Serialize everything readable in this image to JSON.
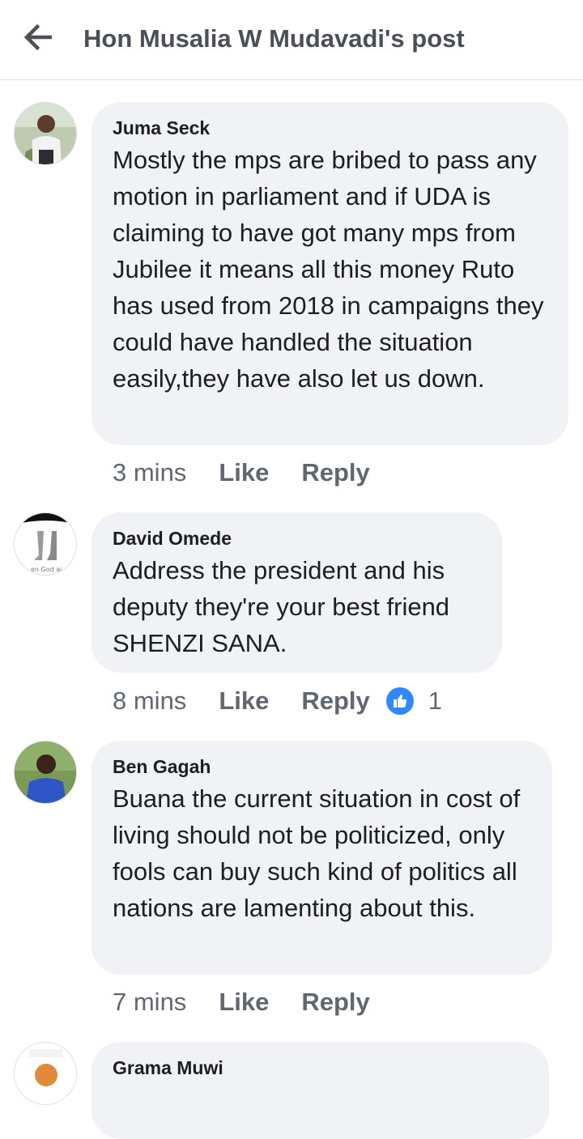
{
  "header": {
    "title": "Hon Musalia W Mudavadi's post",
    "back_icon": "arrow-left-icon"
  },
  "comments": [
    {
      "author": "Juma Seck",
      "text": "Mostly the mps are bribed to pass any motion in parliament and if UDA is claiming to have got many mps from Jubilee it means all this money Ruto has used from 2018 in campaigns they could have handled the situation easily,they have also let us down.",
      "time": "3 mins",
      "like_label": "Like",
      "reply_label": "Reply"
    },
    {
      "author": "David Omede",
      "text": "Address the president and his deputy they're your best friend SHENZI SANA.",
      "time": "8 mins",
      "like_label": "Like",
      "reply_label": "Reply",
      "reaction_count": "1",
      "reaction_icon": "thumbs-up-icon"
    },
    {
      "author": "Ben Gagah",
      "text": "Buana the current situation in cost of living should not be politicized, only fools can buy such kind of politics all nations are lamenting about this.",
      "time": "7 mins",
      "like_label": "Like",
      "reply_label": "Reply"
    },
    {
      "author": "Grama Muwi"
    }
  ],
  "colors": {
    "bubble": "#f0f2f5",
    "meta_text": "#606770",
    "like_badge": "#2e89ff"
  }
}
